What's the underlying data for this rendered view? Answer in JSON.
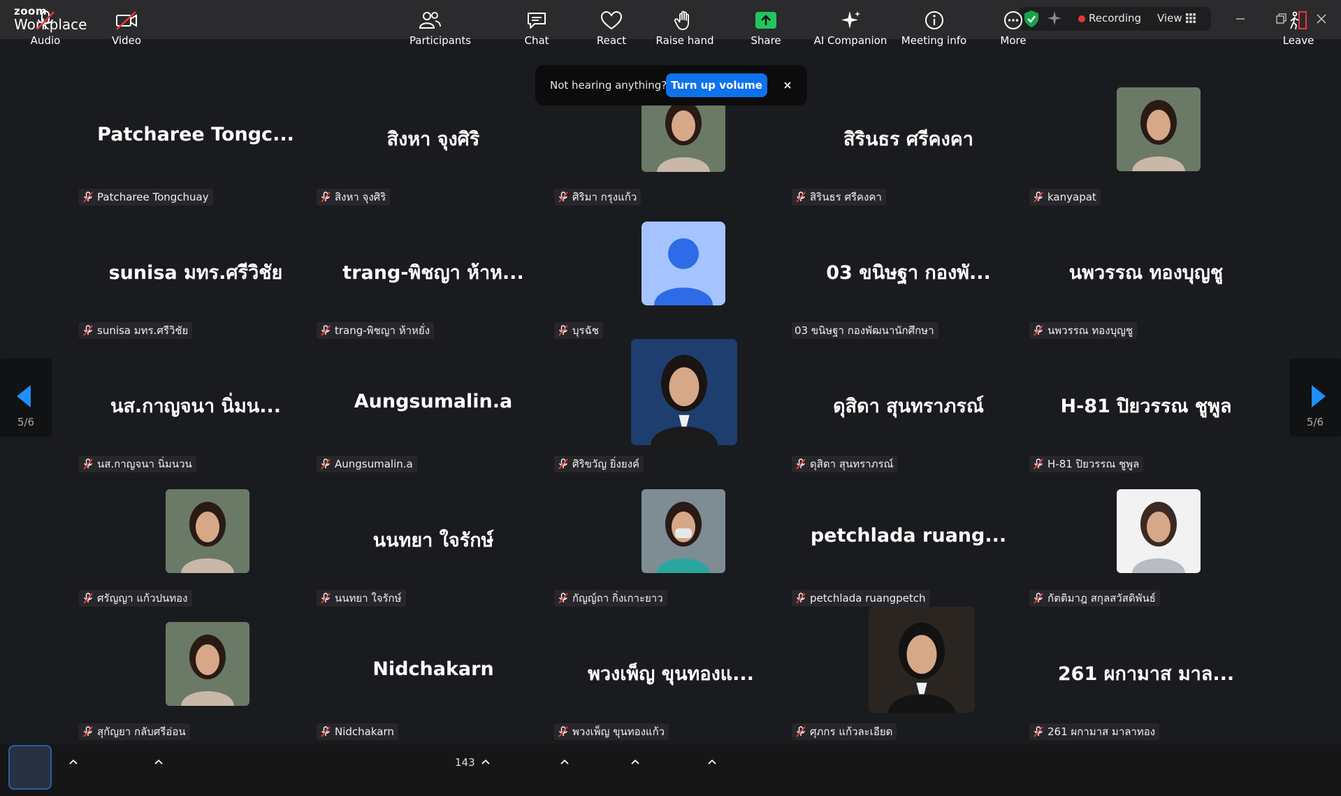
{
  "app": {
    "brand_top": "zoom",
    "brand_bottom": "Workplace"
  },
  "titlebar": {
    "recording_label": "Recording",
    "view_label": "View"
  },
  "toast": {
    "message": "Not hearing anything?",
    "button": "Turn up volume"
  },
  "pagination": {
    "page": "5/6"
  },
  "participants": [
    {
      "big": "Patcharee  Tongc...",
      "label": "Patcharee Tongchuay"
    },
    {
      "big": "สิงหา จุงศิริ",
      "label": "สิงหา จุงศิริ"
    },
    {
      "big": "",
      "label": "ศิริมา กรุงแก้ว"
    },
    {
      "big": "สิรินธร ศรีคงคา",
      "label": "สิรินธร ศรีคงคา"
    },
    {
      "big": "",
      "label": "kanyapat"
    },
    {
      "big": "sunisa มทร.ศรีวิชัย",
      "label": "sunisa มทร.ศรีวิชัย"
    },
    {
      "big": "trang-พิชญา ห้าห...",
      "label": "trang-พิชญา ห้าหยั่ง"
    },
    {
      "big": "",
      "label": "บุรฉัช"
    },
    {
      "big": "03 ขนิษฐา  กองพั...",
      "label": "03 ขนิษฐา  กองพัฒนานักศึกษา"
    },
    {
      "big": "นพวรรณ ทองบุญชู",
      "label": "นพวรรณ ทองบุญชู"
    },
    {
      "big": "นส.กาญจนา นิ่มน...",
      "label": "นส.กาญจนา นิ่มนวน"
    },
    {
      "big": "Aungsumalin.a",
      "label": "Aungsumalin.a"
    },
    {
      "big": "",
      "label": "ศิริขวัญ ยิ่งยงค์"
    },
    {
      "big": "ดุสิดา  สุนทราภรณ์",
      "label": "ดุสิดา  สุนทราภรณ์"
    },
    {
      "big": "H-81 ปิยวรรณ ชูพูล",
      "label": "H-81 ปิยวรรณ ชูพูล"
    },
    {
      "big": "",
      "label": "ศรัญญา แก้วปนทอง"
    },
    {
      "big": "นนทยา ใจรักษ์",
      "label": "นนทยา ใจรักษ์"
    },
    {
      "big": "",
      "label": "กัญญ์ถา กิ่งเกาะยาว"
    },
    {
      "big": "petchlada  ruang...",
      "label": "petchlada ruangpetch"
    },
    {
      "big": "",
      "label": "กัตติมาฎ สกุลสวัสดิพันธ์"
    },
    {
      "big": "",
      "label": "สุกัญยา กลับศรีอ่อน"
    },
    {
      "big": "Nidchakarn",
      "label": "Nidchakarn"
    },
    {
      "big": "พวงเพ็ญ ขุนทองแ...",
      "label": "พวงเพ็ญ ขุนทองแก้ว"
    },
    {
      "big": "",
      "label": "ศุภกร แก้วละเอียด"
    },
    {
      "big": "261 ผกามาส มาล...",
      "label": "261 ผกามาส มาลาทอง"
    }
  ],
  "toolbar": {
    "audio": "Audio",
    "video": "Video",
    "participants": "Participants",
    "participants_count": "143",
    "chat": "Chat",
    "react": "React",
    "raise_hand": "Raise hand",
    "share": "Share",
    "ai_companion": "AI Companion",
    "meeting_info": "Meeting info",
    "more": "More",
    "leave": "Leave"
  },
  "colors": {
    "accent": "#0e72ed",
    "share_green": "#22c55e",
    "mute_red": "#e53935",
    "recording_red": "#e53935"
  }
}
